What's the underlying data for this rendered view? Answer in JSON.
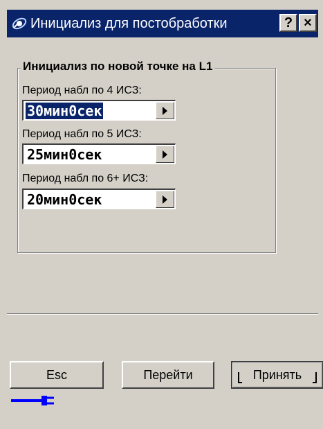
{
  "window": {
    "title": "Инициализ для постобработки",
    "help_label": "?",
    "close_label": "×"
  },
  "group": {
    "title": "Инициализ по новой точке на L1"
  },
  "fields": [
    {
      "label": "Период набл по 4 ИСЗ:",
      "value": "30мин0сек",
      "selected": true
    },
    {
      "label": "Период набл по 5 ИСЗ:",
      "value": "25мин0сек",
      "selected": false
    },
    {
      "label": "Период набл по 6+ ИСЗ:",
      "value": "20мин0сек",
      "selected": false
    }
  ],
  "buttons": {
    "esc": "Esc",
    "go": "Перейти",
    "accept": "Принять"
  },
  "colors": {
    "titlebar": "#0a246a",
    "face": "#d4d0c8",
    "plug": "#0000ff"
  },
  "icons": {
    "app": "satellite-icon",
    "status": "plug-icon"
  }
}
